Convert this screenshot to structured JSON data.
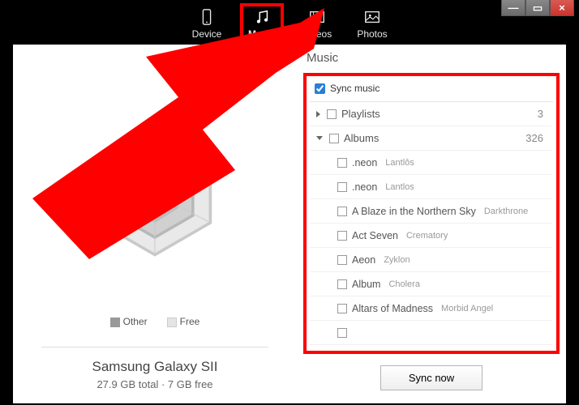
{
  "window": {
    "min": "—",
    "max": "▭",
    "close": "×"
  },
  "nav": {
    "device": "Device",
    "music": "Music",
    "videos": "Videos",
    "photos": "Photos"
  },
  "left": {
    "legend_other": "Other",
    "legend_free": "Free",
    "device_name": "Samsung Galaxy SII",
    "storage": "27.9 GB total · 7 GB free"
  },
  "right": {
    "title": "Music",
    "sync_checkbox_label": "Sync music",
    "sync_checked": true,
    "categories": {
      "playlists": {
        "label": "Playlists",
        "count": "3",
        "expanded": false
      },
      "albums": {
        "label": "Albums",
        "count": "326",
        "expanded": true
      }
    },
    "albums": [
      {
        "title": ".neon",
        "artist": "Lantlôs"
      },
      {
        "title": ".neon",
        "artist": "Lantlos"
      },
      {
        "title": "A Blaze in the Northern Sky",
        "artist": "Darkthrone"
      },
      {
        "title": "Act Seven",
        "artist": "Crematory"
      },
      {
        "title": "Aeon",
        "artist": "Zyklon"
      },
      {
        "title": "Album",
        "artist": "Cholera"
      },
      {
        "title": "Altars of Madness",
        "artist": "Morbid Angel"
      }
    ],
    "sync_button": "Sync now"
  }
}
